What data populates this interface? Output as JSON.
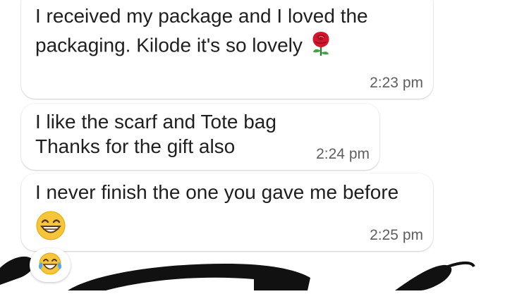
{
  "messages": [
    {
      "text": "I received my package and I loved the\npackaging. Kilode it's so lovely",
      "emoji": "rose-icon",
      "time": "2:23 pm"
    },
    {
      "text": "I like the scarf and Tote bag\nThanks for the gift also",
      "time": "2:24 pm"
    },
    {
      "text": "I never finish the one you gave me before",
      "emoji": "grinning-face-icon",
      "time": "2:25 pm"
    }
  ],
  "reaction": {
    "emoji": "tears-of-joy-icon"
  },
  "colors": {
    "bubble": "#ffffff",
    "text": "#1f1f1f",
    "timestamp": "#5e5e5e",
    "emoji_yellow": "#f6c53a",
    "rose": "#d3152d",
    "ink": "#111111"
  }
}
